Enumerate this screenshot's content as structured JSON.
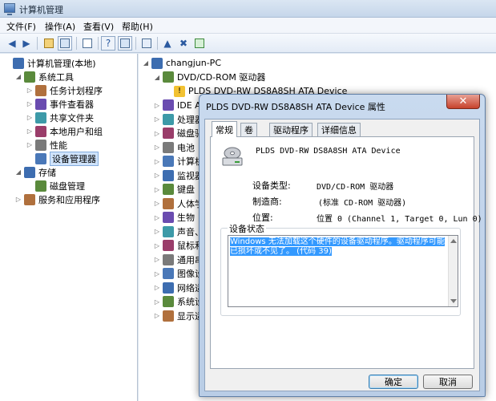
{
  "window": {
    "title": "计算机管理"
  },
  "menu": [
    "文件(F)",
    "操作(A)",
    "查看(V)",
    "帮助(H)"
  ],
  "left_tree": [
    {
      "label": "计算机管理(本地)",
      "icon": "computer-management-icon",
      "level": 0,
      "expand": ""
    },
    {
      "label": "系统工具",
      "icon": "system-tools-icon",
      "level": 1,
      "expand": "◢"
    },
    {
      "label": "任务计划程序",
      "icon": "task-scheduler-icon",
      "level": 2,
      "expand": "▷"
    },
    {
      "label": "事件查看器",
      "icon": "event-viewer-icon",
      "level": 2,
      "expand": "▷"
    },
    {
      "label": "共享文件夹",
      "icon": "shared-folders-icon",
      "level": 2,
      "expand": "▷"
    },
    {
      "label": "本地用户和组",
      "icon": "local-users-icon",
      "level": 2,
      "expand": "▷"
    },
    {
      "label": "性能",
      "icon": "performance-icon",
      "level": 2,
      "expand": "▷"
    },
    {
      "label": "设备管理器",
      "icon": "device-manager-icon",
      "level": 2,
      "expand": "",
      "selected": true
    },
    {
      "label": "存储",
      "icon": "storage-icon",
      "level": 1,
      "expand": "◢"
    },
    {
      "label": "磁盘管理",
      "icon": "disk-management-icon",
      "level": 2,
      "expand": ""
    },
    {
      "label": "服务和应用程序",
      "icon": "services-apps-icon",
      "level": 1,
      "expand": "▷"
    }
  ],
  "right_tree": [
    {
      "label": "changjun-PC",
      "icon": "computer-icon",
      "level": 0,
      "expand": "◢"
    },
    {
      "label": "DVD/CD-ROM 驱动器",
      "icon": "dvd-drive-icon",
      "level": 1,
      "expand": "◢"
    },
    {
      "label": "PLDS DVD-RW DS8A8SH ATA Device",
      "icon": "dvd-device-warning-icon",
      "level": 2,
      "expand": ""
    },
    {
      "label": "IDE A",
      "icon": "ide-controller-icon",
      "level": 1,
      "expand": "▷"
    },
    {
      "label": "处理器",
      "icon": "processor-icon",
      "level": 1,
      "expand": "▷"
    },
    {
      "label": "磁盘驱",
      "icon": "disk-drive-icon",
      "level": 1,
      "expand": "▷"
    },
    {
      "label": "电池",
      "icon": "battery-icon",
      "level": 1,
      "expand": "▷"
    },
    {
      "label": "计算机",
      "icon": "computer-icon",
      "level": 1,
      "expand": "▷"
    },
    {
      "label": "监视器",
      "icon": "monitor-icon",
      "level": 1,
      "expand": "▷"
    },
    {
      "label": "键盘",
      "icon": "keyboard-icon",
      "level": 1,
      "expand": "▷"
    },
    {
      "label": "人体学",
      "icon": "hid-icon",
      "level": 1,
      "expand": "▷"
    },
    {
      "label": "生物",
      "icon": "biometric-icon",
      "level": 1,
      "expand": "▷"
    },
    {
      "label": "声音、",
      "icon": "sound-icon",
      "level": 1,
      "expand": "▷"
    },
    {
      "label": "鼠标和",
      "icon": "mouse-icon",
      "level": 1,
      "expand": "▷"
    },
    {
      "label": "通用串",
      "icon": "usb-icon",
      "level": 1,
      "expand": "▷"
    },
    {
      "label": "图像设",
      "icon": "imaging-icon",
      "level": 1,
      "expand": "▷"
    },
    {
      "label": "网络适",
      "icon": "network-adapter-icon",
      "level": 1,
      "expand": "▷"
    },
    {
      "label": "系统设",
      "icon": "system-devices-icon",
      "level": 1,
      "expand": "▷"
    },
    {
      "label": "显示适",
      "icon": "display-adapter-icon",
      "level": 1,
      "expand": "▷"
    }
  ],
  "dialog": {
    "title": "PLDS DVD-RW DS8A8SH ATA Device 属性",
    "close_glyph": "✕",
    "tabs": [
      "常规",
      "卷",
      "驱动程序",
      "详细信息"
    ],
    "device_name": "PLDS DVD-RW DS8A8SH ATA Device",
    "props": [
      {
        "label": "设备类型:",
        "value": "DVD/CD-ROM 驱动器"
      },
      {
        "label": "制造商:",
        "value": "(标准 CD-ROM 驱动器)"
      },
      {
        "label": "位置:",
        "value": "位置 0 (Channel 1, Target 0, Lun 0)"
      }
    ],
    "status_label": "设备状态",
    "status_text": "Windows 无法加载这个硬件的设备驱动程序。驱动程序可能已损坏或不见了。 (代码 39)",
    "ok_label": "确定",
    "cancel_label": "取消"
  },
  "colors": {
    "selection": "#3399ff",
    "title_bar": "#c5d6ea",
    "close_button": "#c7422c"
  }
}
